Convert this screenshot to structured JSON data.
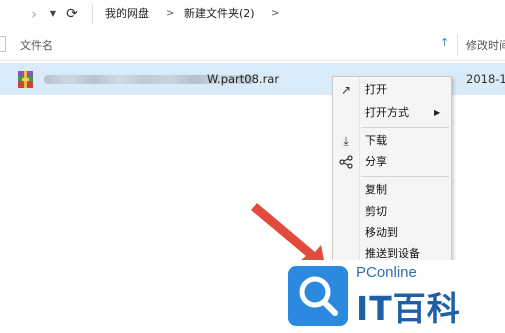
{
  "nav": {
    "back_icon": "›",
    "dropdown_icon": "▼",
    "refresh_icon": "⟳",
    "breadcrumbs": [
      "我的网盘",
      "新建文件夹(2)"
    ],
    "separator": ">"
  },
  "columns": {
    "name_label": "文件名",
    "sort_icon": "↑",
    "date_label": "修改时间"
  },
  "file": {
    "name_visible": "W.part08.rar",
    "date": "2018-1",
    "icon": "winrar-archive-icon"
  },
  "context_menu": {
    "items": [
      {
        "icon": "↗",
        "label": "打开"
      },
      {
        "icon": "",
        "label": "打开方式",
        "submenu_icon": "▶"
      },
      {
        "icon": "⤓",
        "label": "下载"
      },
      {
        "icon": "share",
        "label": "分享"
      },
      {
        "icon": "",
        "label": "复制"
      },
      {
        "icon": "",
        "label": "剪切"
      },
      {
        "icon": "",
        "label": "移动到"
      },
      {
        "icon": "",
        "label": "推送到设备"
      }
    ]
  },
  "watermark": {
    "brand_small": "PConline",
    "brand_large": "IT百科"
  },
  "colors": {
    "selection": "#d9ebf9",
    "arrow": "#e24a3b",
    "watermark_blue": "#2b8ae0"
  }
}
